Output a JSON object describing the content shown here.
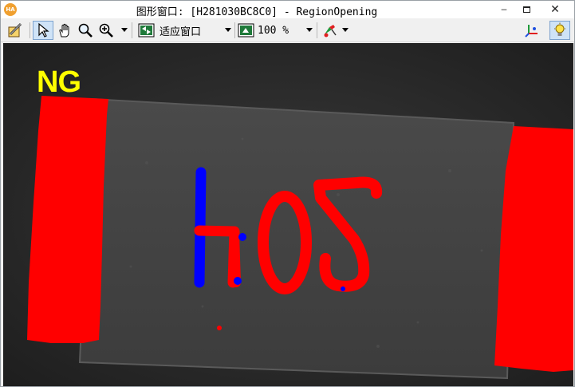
{
  "window": {
    "app_icon_text": "HA",
    "title": "图形窗口: [H281030BC8C0] - RegionOpening",
    "minimize": "–",
    "close": "✕"
  },
  "toolbar": {
    "fit_label": "适应窗口",
    "zoom_label": "100 %",
    "icons": [
      "edit-region-icon",
      "pointer-icon",
      "hand-pan-icon",
      "magnifier-icon",
      "zoom-in-icon",
      "fit-window-icon",
      "zoom-percent-icon",
      "color-palette-icon",
      "axes-icon",
      "lightbulb-icon"
    ]
  },
  "canvas": {
    "overlay_text": "NG",
    "overlay_color": "#ffff00",
    "region_colors": {
      "primary": "#ff0000",
      "secondary": "#0000ff"
    },
    "characters": [
      "2",
      "0",
      "4"
    ]
  }
}
